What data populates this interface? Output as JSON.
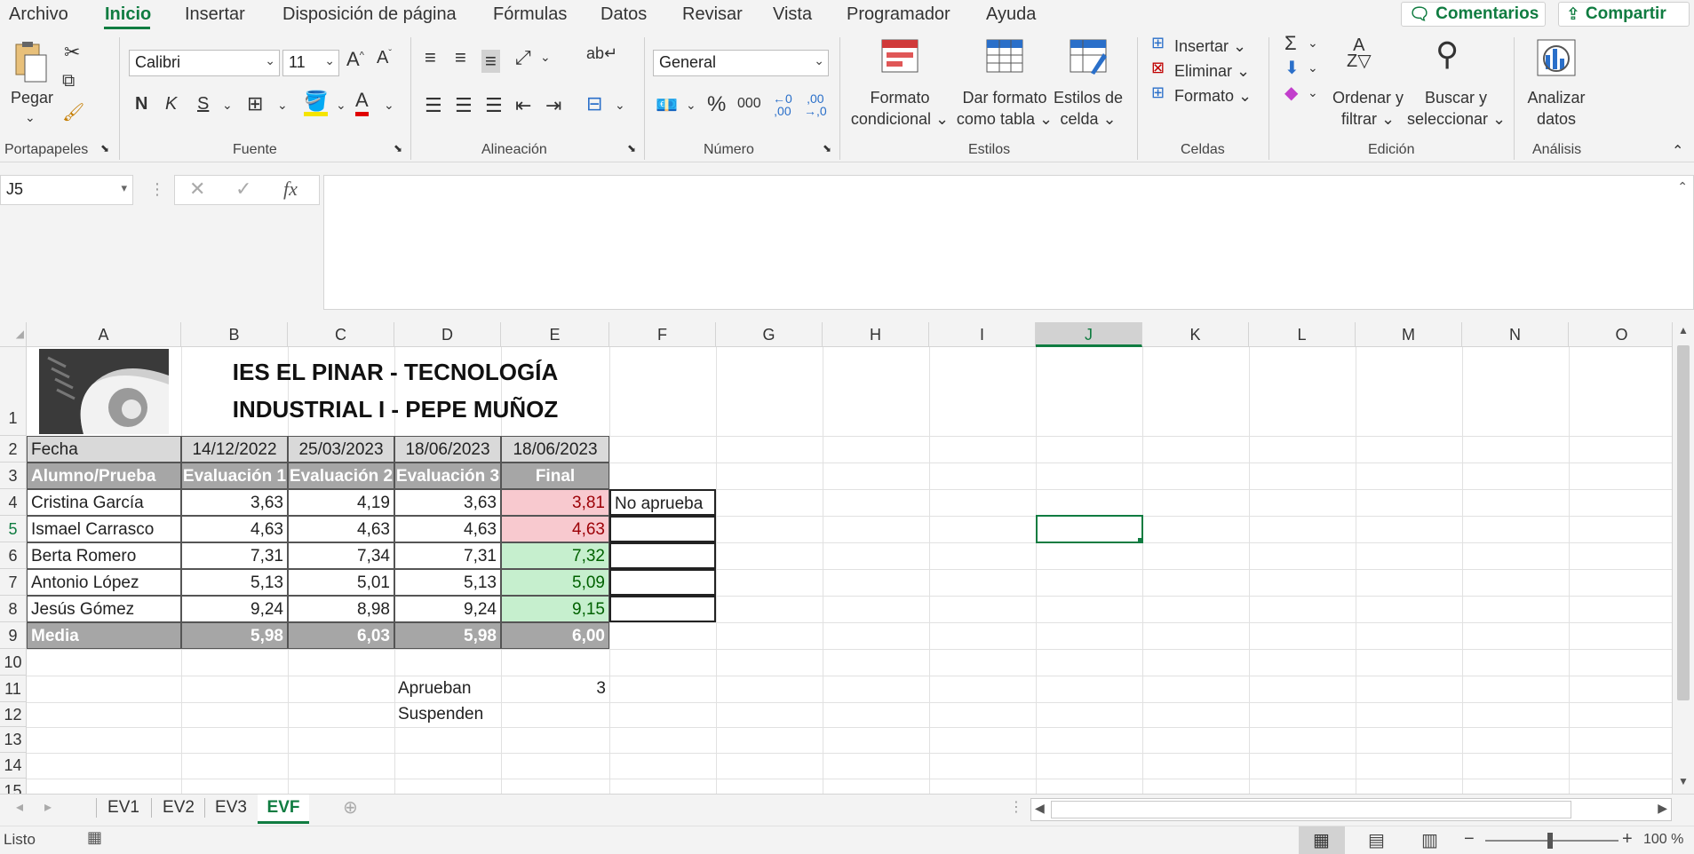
{
  "menu": {
    "items": [
      "Archivo",
      "Inicio",
      "Insertar",
      "Disposición de página",
      "Fórmulas",
      "Datos",
      "Revisar",
      "Vista",
      "Programador",
      "Ayuda"
    ],
    "comments_label": "Comentarios",
    "share_label": "Compartir"
  },
  "ribbon": {
    "clipboard": {
      "paste": "Pegar",
      "group": "Portapapeles"
    },
    "font": {
      "name": "Calibri",
      "size": "11",
      "bold": "N",
      "italic": "K",
      "underline": "S",
      "group": "Fuente"
    },
    "alignment": {
      "group": "Alineación"
    },
    "number": {
      "format": "General",
      "group": "Número"
    },
    "styles": {
      "conditional_l1": "Formato",
      "conditional_l2": "condicional",
      "table_l1": "Dar formato",
      "table_l2": "como tabla",
      "cell_l1": "Estilos de",
      "cell_l2": "celda",
      "group": "Estilos"
    },
    "cells": {
      "insert": "Insertar",
      "delete": "Eliminar",
      "format": "Formato",
      "group": "Celdas"
    },
    "editing": {
      "sort_l1": "Ordenar y",
      "sort_l2": "filtrar",
      "find_l1": "Buscar y",
      "find_l2": "seleccionar",
      "group": "Edición"
    },
    "analysis": {
      "analyze_l1": "Analizar",
      "analyze_l2": "datos",
      "group": "Análisis"
    }
  },
  "formula_bar": {
    "name_box": "J5",
    "formula": ""
  },
  "columns": [
    "A",
    "B",
    "C",
    "D",
    "E",
    "F",
    "G",
    "H",
    "I",
    "J",
    "K",
    "L",
    "M",
    "N",
    "O"
  ],
  "rows": [
    "1",
    "2",
    "3",
    "4",
    "5",
    "6",
    "7",
    "8",
    "9",
    "10",
    "11",
    "12",
    "13",
    "14",
    "15"
  ],
  "sheet": {
    "title_line1": "IES EL PINAR - TECNOLOGÍA",
    "title_line2": "INDUSTRIAL I - PEPE MUÑOZ",
    "date_row": [
      "Fecha",
      "14/12/2022",
      "25/03/2023",
      "18/06/2023",
      "18/06/2023"
    ],
    "header_row": [
      "Alumno/Prueba",
      "Evaluación 1",
      "Evaluación 2",
      "Evaluación 3",
      "Final"
    ],
    "students": [
      {
        "name": "Cristina García",
        "e1": "3,63",
        "e2": "4,19",
        "e3": "3,63",
        "final": "3,81",
        "note": "No aprueba"
      },
      {
        "name": "Ismael Carrasco",
        "e1": "4,63",
        "e2": "4,63",
        "e3": "4,63",
        "final": "4,63",
        "note": ""
      },
      {
        "name": "Berta Romero",
        "e1": "7,31",
        "e2": "7,34",
        "e3": "7,31",
        "final": "7,32",
        "note": ""
      },
      {
        "name": "Antonio López",
        "e1": "5,13",
        "e2": "5,01",
        "e3": "5,13",
        "final": "5,09",
        "note": ""
      },
      {
        "name": "Jesús Gómez",
        "e1": "9,24",
        "e2": "8,98",
        "e3": "9,24",
        "final": "9,15",
        "note": ""
      }
    ],
    "mean_row": [
      "Media",
      "5,98",
      "6,03",
      "5,98",
      "6,00"
    ],
    "pass_label": "Aprueban",
    "pass_value": "3",
    "fail_label": "Suspenden"
  },
  "sheet_tabs": [
    "EV1",
    "EV2",
    "EV3",
    "EVF"
  ],
  "active_tab": "EVF",
  "status": {
    "ready": "Listo",
    "zoom": "100 %"
  },
  "colors": {
    "accent": "#107c41",
    "fail_fill": "#f8c9cf",
    "fail_text": "#9c0006",
    "pass_fill": "#c6efce",
    "pass_text": "#006100",
    "header_fill": "#a6a6a6",
    "date_fill": "#d9d9d9"
  }
}
